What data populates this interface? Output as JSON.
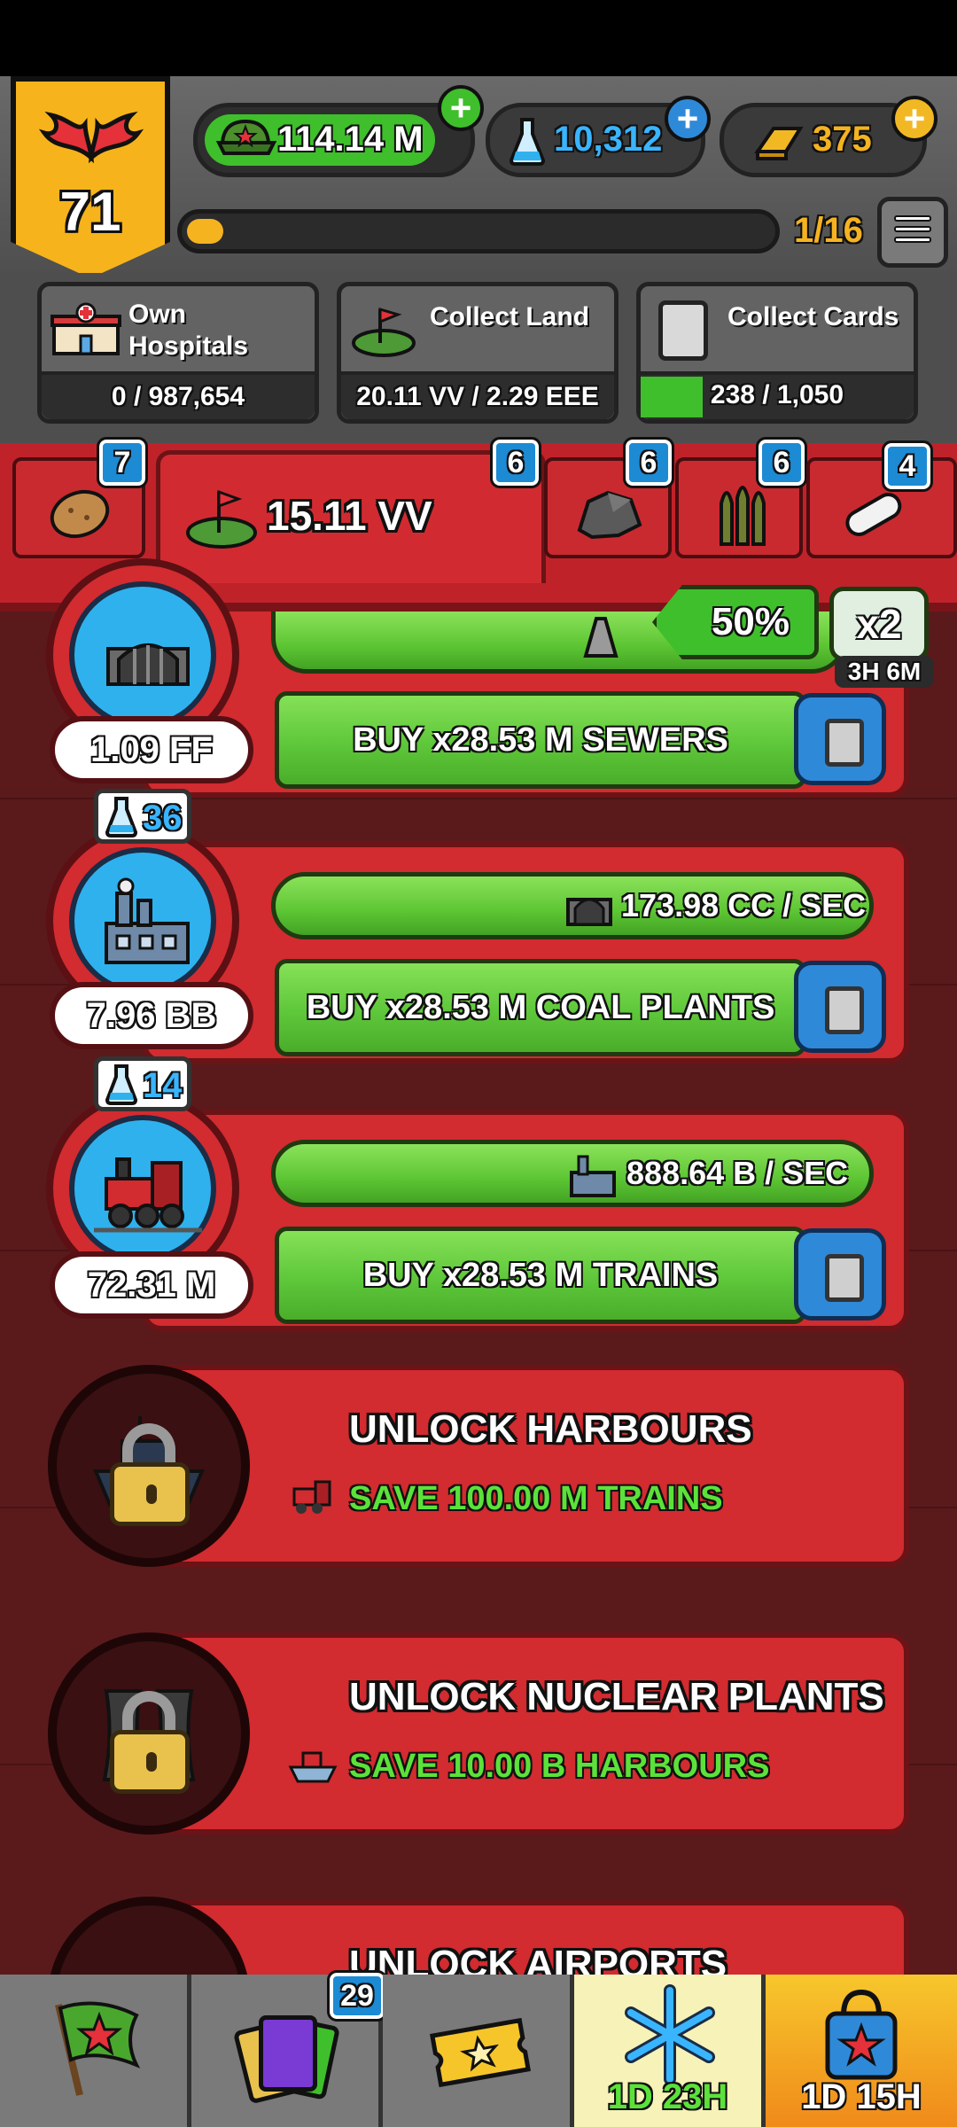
{
  "player": {
    "level": "71"
  },
  "currencies": {
    "cash": {
      "value": "114.14 M",
      "icon": "cash-icon"
    },
    "science": {
      "value": "10,312",
      "icon": "flask-icon"
    },
    "gold": {
      "value": "375",
      "icon": "gold-bar-icon"
    }
  },
  "progress": {
    "label": "1/16",
    "fraction": 0.0625
  },
  "objectives": [
    {
      "label_line1": "Own",
      "label_line2": "Hospitals",
      "value": "0 / 987,654"
    },
    {
      "label": "Collect Land",
      "value": "20.11 VV / 2.29 EEE"
    },
    {
      "label": "Collect Cards",
      "value": "238 / 1,050",
      "fraction": 0.227
    }
  ],
  "tabs": {
    "potato_badge": "7",
    "land_value": "15.11 VV",
    "land_badge": "6",
    "rock_badge": "6",
    "ammo_badge": "6",
    "pill_badge": "4"
  },
  "boost": {
    "percent": "50%",
    "multiplier": "x2",
    "timer": "3H 6M"
  },
  "producers": [
    {
      "name": "sewers",
      "value": "1.09 FF",
      "button": "BUY x28.53 M SEWERS"
    },
    {
      "name": "coal-plants",
      "science": "36",
      "value": "7.96 BB",
      "rate": "173.98 CC / SEC",
      "button": "BUY x28.53 M COAL PLANTS"
    },
    {
      "name": "trains",
      "science": "14",
      "value": "72.31 M",
      "rate": "888.64 B / SEC",
      "button": "BUY x28.53 M TRAINS"
    }
  ],
  "locked": [
    {
      "title": "UNLOCK HARBOURS",
      "requirement": "SAVE 100.00 M TRAINS"
    },
    {
      "title": "UNLOCK NUCLEAR PLANTS",
      "requirement": "SAVE 10.00 B HARBOURS"
    },
    {
      "title": "UNLOCK AIRPORTS"
    }
  ],
  "nav": {
    "cards_badge": "29",
    "freeze_timer": "1D 23H",
    "shop_timer": "1D 15H"
  }
}
